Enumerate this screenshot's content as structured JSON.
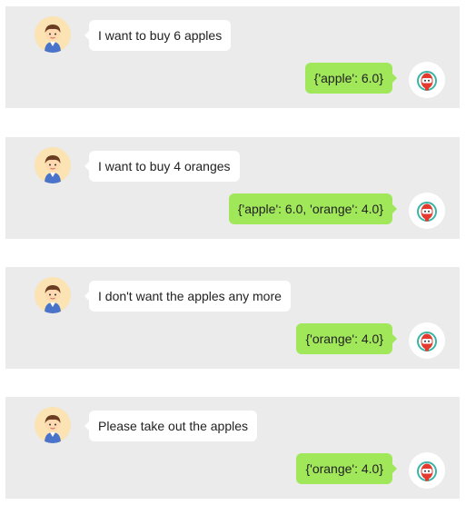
{
  "icons": {
    "user_avatar": "boy-avatar-icon",
    "bot_avatar": "robot-avatar-icon"
  },
  "colors": {
    "panel": "#ebebeb",
    "user_bubble": "#ffffff",
    "bot_bubble": "#a0e75a",
    "avatar_bg": "#fbe3b4"
  },
  "conversation": [
    {
      "user": "I want to buy 6 apples",
      "bot": "{'apple': 6.0}"
    },
    {
      "user": "I want to buy 4 oranges",
      "bot": "{'apple': 6.0, 'orange': 4.0}"
    },
    {
      "user": "I don't want the apples any more",
      "bot": "{'orange': 4.0}"
    },
    {
      "user": "Please take out the apples",
      "bot": "{'orange': 4.0}"
    }
  ]
}
